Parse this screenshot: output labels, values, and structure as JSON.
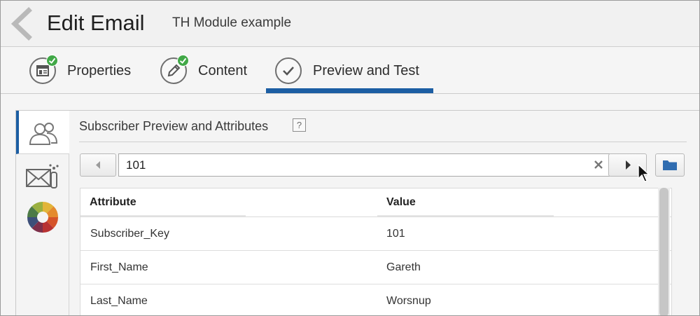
{
  "header": {
    "title": "Edit Email",
    "subtitle": "TH Module example"
  },
  "tabs": [
    {
      "label": "Properties",
      "icon": "properties-icon",
      "complete": true
    },
    {
      "label": "Content",
      "icon": "pencil-icon",
      "complete": true
    },
    {
      "label": "Preview and Test",
      "icon": "check-circle-icon",
      "active": true
    }
  ],
  "side_rail": [
    {
      "icon": "subscribers-icon",
      "active": true
    },
    {
      "icon": "email-send-icon"
    },
    {
      "icon": "color-wheel-icon"
    }
  ],
  "panel": {
    "title": "Subscriber Preview and Attributes",
    "help": "?",
    "search_value": "101"
  },
  "table": {
    "headers": [
      "Attribute",
      "Value"
    ],
    "rows": [
      {
        "attribute": "Subscriber_Key",
        "value": "101"
      },
      {
        "attribute": "First_Name",
        "value": "Gareth"
      },
      {
        "attribute": "Last_Name",
        "value": "Worsnup"
      }
    ]
  },
  "colors": {
    "accent": "#1c5ea3",
    "check": "#41a847"
  }
}
